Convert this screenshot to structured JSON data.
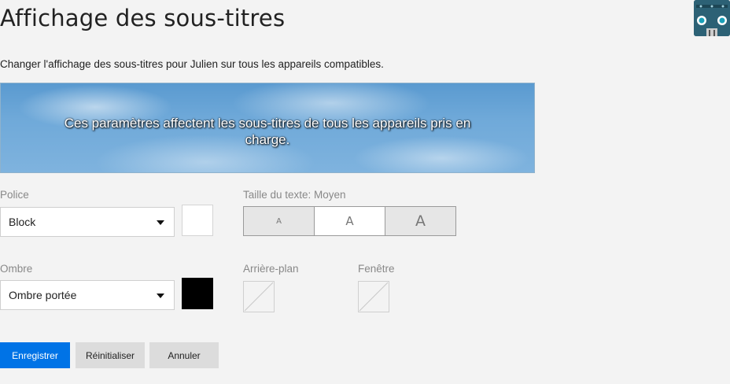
{
  "header": {
    "title": "Affichage des sous-titres",
    "avatar_icon": "robot-avatar-icon"
  },
  "description": "Changer l'affichage des sous-titres pour Julien sur tous les appareils compatibles.",
  "preview": {
    "text": "Ces paramètres affectent les sous-titres de tous les appareils pris en charge."
  },
  "font": {
    "label": "Police",
    "selected": "Block",
    "color": "#ffffff"
  },
  "text_size": {
    "label": "Taille du texte: Moyen",
    "options": [
      "A",
      "A",
      "A"
    ],
    "selected_index": 1
  },
  "shadow": {
    "label": "Ombre",
    "selected": "Ombre portée",
    "color": "#000000"
  },
  "background": {
    "label": "Arrière-plan"
  },
  "window": {
    "label": "Fenêtre"
  },
  "actions": {
    "save": "Enregistrer",
    "reset": "Réinitialiser",
    "cancel": "Annuler"
  },
  "colors": {
    "accent": "#0073e6",
    "page_bg": "#f3f3f3"
  }
}
